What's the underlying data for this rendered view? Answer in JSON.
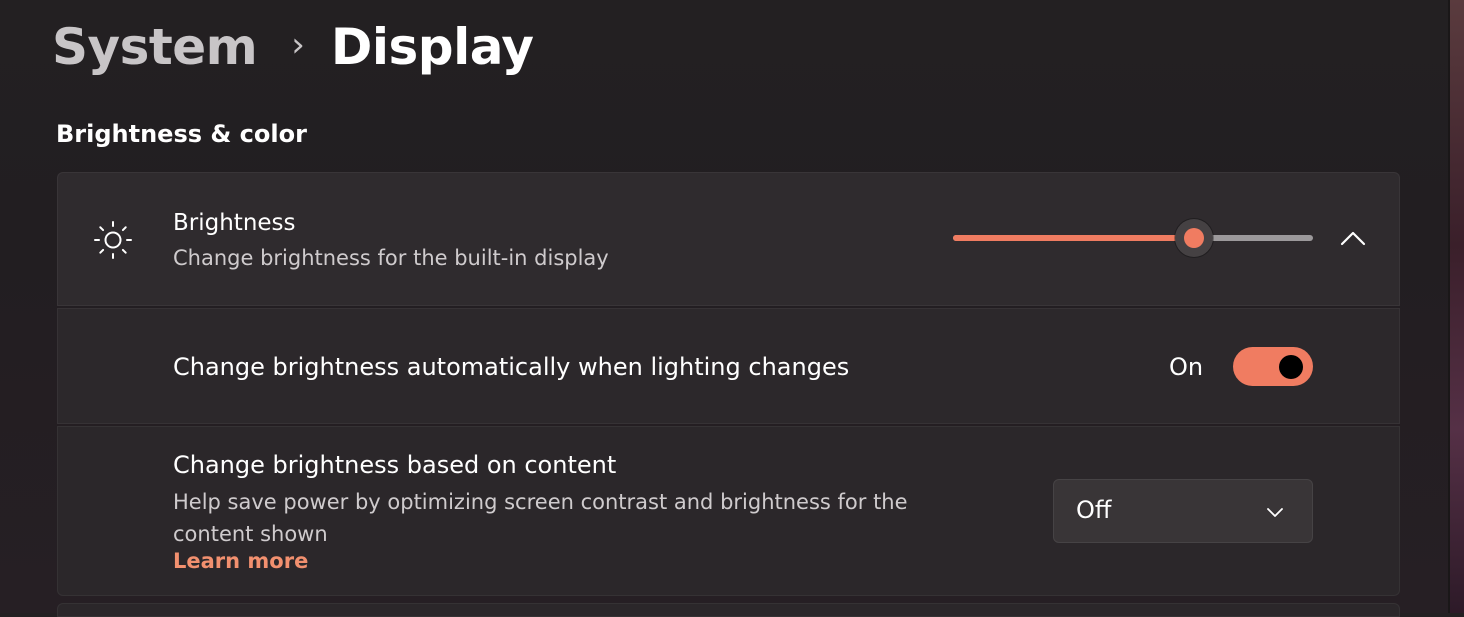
{
  "breadcrumb": {
    "parent": "System",
    "separator": "›",
    "current": "Display"
  },
  "section": {
    "title": "Brightness & color"
  },
  "brightness": {
    "title": "Brightness",
    "description": "Change brightness for the built-in display",
    "icon": "sun-icon",
    "slider_value": 0.67,
    "expand_icon": "chevron-up-icon"
  },
  "auto_brightness": {
    "label": "Change brightness automatically when lighting changes",
    "state_label": "On",
    "enabled": true
  },
  "content_brightness": {
    "title": "Change brightness based on content",
    "description": "Help save power by optimizing screen contrast and brightness for the content shown",
    "learn_more": "Learn more",
    "selected": "Off",
    "dropdown_icon": "chevron-down-icon"
  },
  "colors": {
    "accent": "#f07c61",
    "link": "#f2906f",
    "background": "#221e21",
    "card": "#2f2b2e"
  }
}
